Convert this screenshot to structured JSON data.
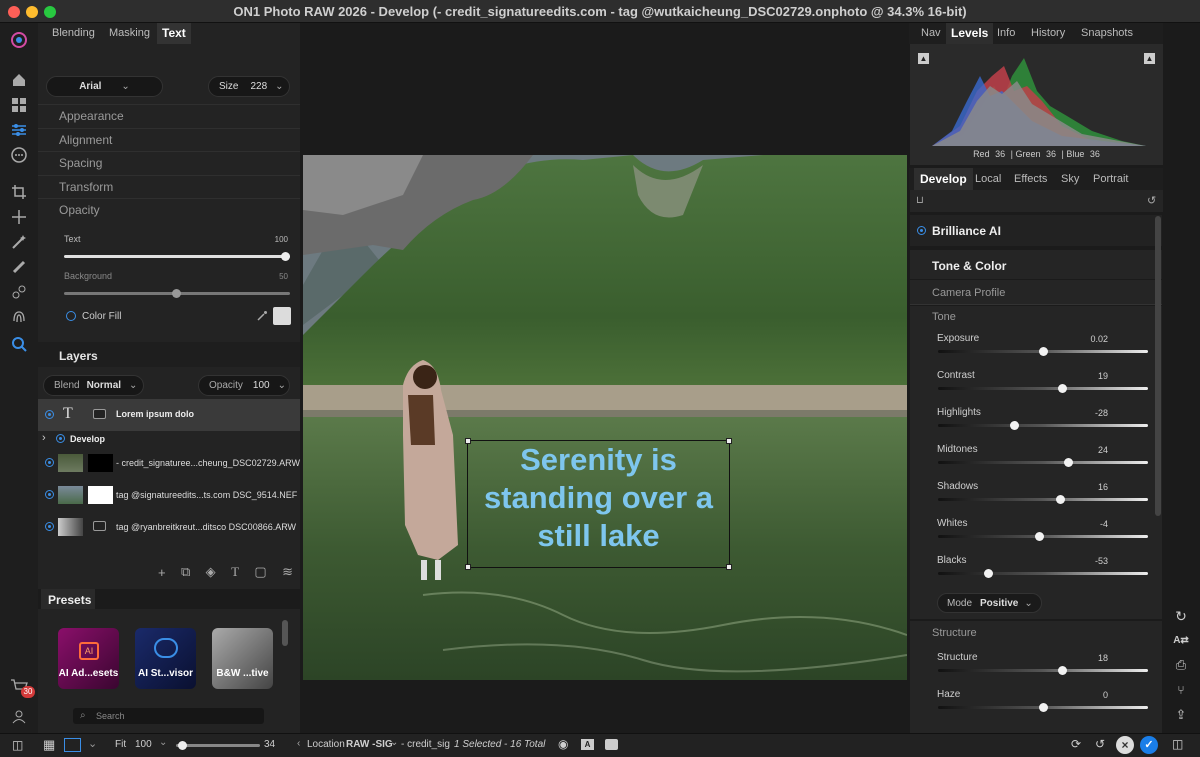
{
  "window": {
    "title": "ON1 Photo RAW 2026 - Develop (- credit_signatureedits.com - tag @wutkaicheung_DSC02729.onphoto @ 34.3% 16-bit)"
  },
  "left_tabs": [
    "Blending",
    "Masking",
    "Text"
  ],
  "text_panel": {
    "font": "Arial",
    "size_label": "Size",
    "size_value": "228",
    "sections": [
      "Appearance",
      "Alignment",
      "Spacing",
      "Transform",
      "Opacity"
    ],
    "text_label": "Text",
    "text_value": "100",
    "text_level": 1.0,
    "background_label": "Background",
    "background_value": "50",
    "background_level": 0.5,
    "color_fill_label": "Color Fill"
  },
  "layers": {
    "title": "Layers",
    "blend_label": "Blend",
    "blend_value": "Normal",
    "opacity_label": "Opacity",
    "opacity_value": "100",
    "items": [
      {
        "name": "Lorem ipsum dolo"
      },
      {
        "name": "Develop"
      },
      {
        "name": "- credit_signaturee...cheung_DSC02729.ARW"
      },
      {
        "name": "tag @signatureedits...ts.com DSC_9514.NEF"
      },
      {
        "name": "tag @ryanbreitkreut...ditsco DSC00866.ARW"
      }
    ]
  },
  "presets": {
    "title": "Presets",
    "items": [
      {
        "label": "AI Ad...esets"
      },
      {
        "label": "AI St...visor"
      },
      {
        "label": "B&W ...tive"
      }
    ],
    "search_placeholder": "Search",
    "cart_badge": "30"
  },
  "canvas": {
    "overlay_text_line1": "Serenity is",
    "overlay_text_line2": "standing over a",
    "overlay_text_line3": "still lake"
  },
  "right_tabs_top": [
    "Nav",
    "Levels",
    "Info",
    "History",
    "Snapshots"
  ],
  "histogram": {
    "red_label": "Red",
    "red": "36",
    "green_label": "| Green",
    "green": "36",
    "blue_label": "| Blue",
    "blue": "36"
  },
  "right_tabs_mid": [
    "Develop",
    "Local",
    "Effects",
    "Sky",
    "Portrait"
  ],
  "develop": {
    "brilliance": "Brilliance AI",
    "tone_color": "Tone & Color",
    "camera_profile": "Camera Profile",
    "tone": "Tone",
    "sliders": [
      {
        "label": "Exposure",
        "value": "0.02",
        "pos": 0.5
      },
      {
        "label": "Contrast",
        "value": "19",
        "pos": 0.59
      },
      {
        "label": "Highlights",
        "value": "-28",
        "pos": 0.36
      },
      {
        "label": "Midtones",
        "value": "24",
        "pos": 0.62
      },
      {
        "label": "Shadows",
        "value": "16",
        "pos": 0.58
      },
      {
        "label": "Whites",
        "value": "-4",
        "pos": 0.48
      },
      {
        "label": "Blacks",
        "value": "-53",
        "pos": 0.24
      }
    ],
    "mode_label": "Mode",
    "mode_value": "Positive",
    "structure_header": "Structure",
    "structure_sliders": [
      {
        "label": "Structure",
        "value": "18",
        "pos": 0.59
      },
      {
        "label": "Haze",
        "value": "0",
        "pos": 0.5
      }
    ]
  },
  "bottom": {
    "fit": "Fit",
    "zoom": "100",
    "zoom_end": "34",
    "location_label": "Location",
    "location_value": "RAW -SIG",
    "location_file": "- credit_sig",
    "selection": "1 Selected - 16 Total"
  }
}
